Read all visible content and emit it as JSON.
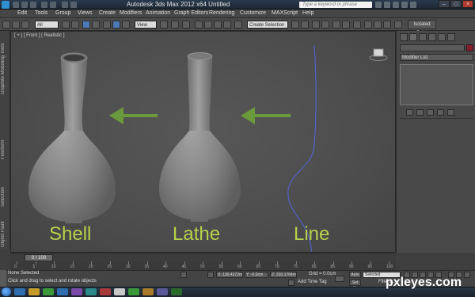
{
  "title": "Autodesk 3ds Max  2012 x64      Untitled",
  "search_placeholder": "Type a keyword or phrase",
  "menu": [
    "Edit",
    "Tools",
    "Group",
    "Views",
    "Create",
    "Modifiers",
    "Animation",
    "Graph Editors",
    "Rendering",
    "Customize",
    "MAXScript",
    "Help"
  ],
  "toolbar": {
    "selection_filter": "All",
    "view_dropdown": "View",
    "named_selection": "Create Selection Se...",
    "explorer_tab": "Isolated Point"
  },
  "ribbon_tabs": [
    "Graphite Modeling Tools",
    "Freeform",
    "Selection",
    "Object Paint"
  ],
  "viewport": {
    "label": "[ + ] [ Front ] [ Realistic ]",
    "labels": {
      "shell": "Shell",
      "lathe": "Lathe",
      "line": "Line"
    },
    "arrow_color": "#6a9a3c",
    "label_color": "#b7d24a",
    "spline_color": "#5560c8"
  },
  "command_panel": {
    "modifier_list": "Modifier List"
  },
  "time_slider": {
    "position": "0 / 100",
    "ticks": [
      0,
      5,
      10,
      15,
      20,
      25,
      30,
      35,
      40,
      45,
      50,
      55,
      60,
      65,
      70,
      75,
      80,
      85,
      90,
      95,
      100
    ]
  },
  "status": {
    "selection": "None Selected",
    "prompt": "Click and drag to select and rotate objects",
    "x": "X: 130.4272m",
    "y": "Y: -0.0cm",
    "z": "Z: 310.1764m",
    "grid": "Grid = 0.0cm",
    "add_time_tag": "Add Time Tag",
    "auto": "Auto",
    "set_key": "Set K.",
    "selected": "Selected",
    "filters": "Filters..."
  },
  "watermark": "pxleyes.com"
}
